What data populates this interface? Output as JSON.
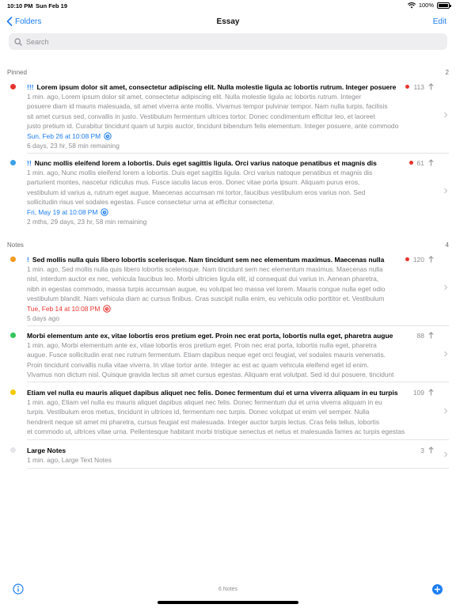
{
  "status_bar": {
    "time": "10:10 PM",
    "date": "Sun Feb 19",
    "battery": "100%",
    "wifi_icon": "wifi-icon",
    "battery_icon": "battery-icon"
  },
  "nav": {
    "back_label": "Folders",
    "title": "Essay",
    "edit_label": "Edit"
  },
  "search": {
    "placeholder": "Search",
    "value": ""
  },
  "colors": {
    "accent": "#1a7cf2",
    "red": "#e9332d",
    "secondary_text": "#8e8e93"
  },
  "pinned": {
    "label": "Pinned",
    "count": "2",
    "notes": [
      {
        "dot_color": "#e9332d",
        "prefix": "!!!",
        "title": "Lorem ipsum dolor sit amet, consectetur adipiscing elit. Nulla molestie ligula ac lobortis rutrum. Integer posuere",
        "has_red_dot": true,
        "count": "113",
        "body_lines": [
          "1 min. ago, Lorem ipsum dolor sit amet, consectetur adipiscing elit. Nulla molestie ligula ac lobortis rutrum. Integer",
          "posuere diam id mauris malesuada, sit amet viverra ante mollis. Vivamus tempor pulvinar tempor. Nam nulla turpis, facilisis",
          "sit amet cursus sed, convallis in justo. Vestibulum fermentum ultrices tortor. Donec condimentum efficitur leo, et laoreet",
          "justo pretium id. Curabitur tincidunt quam ut turpis auctor, tincidunt bibendum felis elementum. Integer posuere, ante commodo"
        ],
        "reminder": "Sun, Feb 26 at 10:08 PM",
        "reminder_color": "#1a7cf2",
        "remaining": "6 days, 23 hr, 58 min remaining"
      },
      {
        "dot_color": "#3ba1e8",
        "prefix": "!!",
        "title": "Nunc mollis eleifend lorem a lobortis. Duis eget sagittis ligula. Orci varius natoque penatibus et magnis dis",
        "has_red_dot": true,
        "count": "61",
        "body_lines": [
          "1 min. ago, Nunc mollis eleifend lorem a lobortis. Duis eget sagittis ligula. Orci varius natoque penatibus et magnis dis",
          "parturient montes, nascetur ridiculus mus. Fusce iaculis lacus eros. Donec vitae porta ipsum. Aliquam purus eros,",
          "vestibulum id varius a, rutrum eget augue. Maecenas accumsan mi tortor, faucibus vestibulum eros varius non. Sed",
          "sollicitudin risus vel sodales egestas. Fusce consectetur urna at efficitur consectetur."
        ],
        "reminder": "Fri, May 19 at 10:08 PM",
        "reminder_color": "#1a7cf2",
        "remaining": "2 mths, 29 days, 23 hr, 58 min remaining"
      }
    ]
  },
  "notes_section": {
    "label": "Notes",
    "count": "4",
    "notes": [
      {
        "dot_color": "#f39a1e",
        "prefix": "!",
        "title": "Sed mollis nulla quis libero lobortis scelerisque. Nam tincidunt sem nec elementum maximus. Maecenas nulla",
        "has_red_dot": true,
        "count": "120",
        "body_lines": [
          "1 min. ago, Sed mollis nulla quis libero lobortis scelerisque. Nam tincidunt sem nec elementum maximus. Maecenas nulla",
          "nisl, interdum auctor ex nec, vehicula faucibus leo. Morbi ultricies ligula elit, id consequat dui varius in. Aenean pharetra,",
          "nibh in egestas commodo, massa turpis accumsan augue, eu volutpat leo massa vel lorem. Mauris congue nulla eget odio",
          "vestibulum blandit. Nam vehicula diam ac cursus finibus. Cras suscipit nulla enim, eu vehicula odio porttitor et. Vestibulum"
        ],
        "reminder": "Tue, Feb 14 at 10:08 PM",
        "reminder_color": "#e9332d",
        "remaining": "5 days ago"
      },
      {
        "dot_color": "#34c759",
        "prefix": "",
        "title": "Morbi elementum ante ex, vitae lobortis eros pretium eget. Proin nec erat porta, lobortis nulla eget, pharetra augue",
        "has_red_dot": false,
        "count": "88",
        "body_lines": [
          "1 min. ago, Morbi elementum ante ex, vitae lobortis eros pretium eget. Proin nec erat porta, lobortis nulla eget, pharetra",
          "augue. Fusce sollicitudin erat nec rutrum fermentum. Etiam dapibus neque eget orci feugiat, vel sodales mauris venenatis.",
          "Proin tincidunt convallis nulla vitae viverra. In vitae tortor ante. Integer ac est ac quam vehicula eleifend eget id enim.",
          "Vivamus non dictum nisl. Quisque gravida lectus sit amet cursus egestas. Aliquam erat volutpat. Sed id dui posuere, tincidunt"
        ],
        "reminder": "",
        "reminder_color": "#1a7cf2",
        "remaining": ""
      },
      {
        "dot_color": "#f5cc00",
        "prefix": "",
        "title": "Etiam vel nulla eu mauris aliquet dapibus aliquet nec felis. Donec fermentum dui et urna viverra aliquam in eu turpis",
        "has_red_dot": false,
        "count": "109",
        "body_lines": [
          "1 min. ago, Etiam vel nulla eu mauris aliquet dapibus aliquet nec felis. Donec fermentum dui et urna viverra aliquam in eu",
          "turpis. Vestibulum eros metus, tincidunt in ultrices id, fermentum nec turpis. Donec volutpat ut enim vel semper. Nulla",
          "hendrerit neque sit amet mi pharetra, cursus feugiat est malesuada. Integer auctor turpis lectus. Cras felis tellus, lobortis",
          "et commodo ut, ultrices vitae urna. Pellentesque habitant morbi tristique senectus et netus et malesuada fames ac turpis egestas"
        ],
        "reminder": "",
        "reminder_color": "#1a7cf2",
        "remaining": ""
      },
      {
        "dot_color": "#e5e5ea",
        "prefix": "",
        "title": "Large Notes",
        "has_red_dot": false,
        "count": "3",
        "body_lines": [
          "1 min. ago, Large Text Notes"
        ],
        "reminder": "",
        "reminder_color": "#1a7cf2",
        "remaining": ""
      }
    ]
  },
  "toolbar": {
    "note_count": "6 Notes",
    "info_icon": "info-icon",
    "add_icon": "add-icon"
  }
}
